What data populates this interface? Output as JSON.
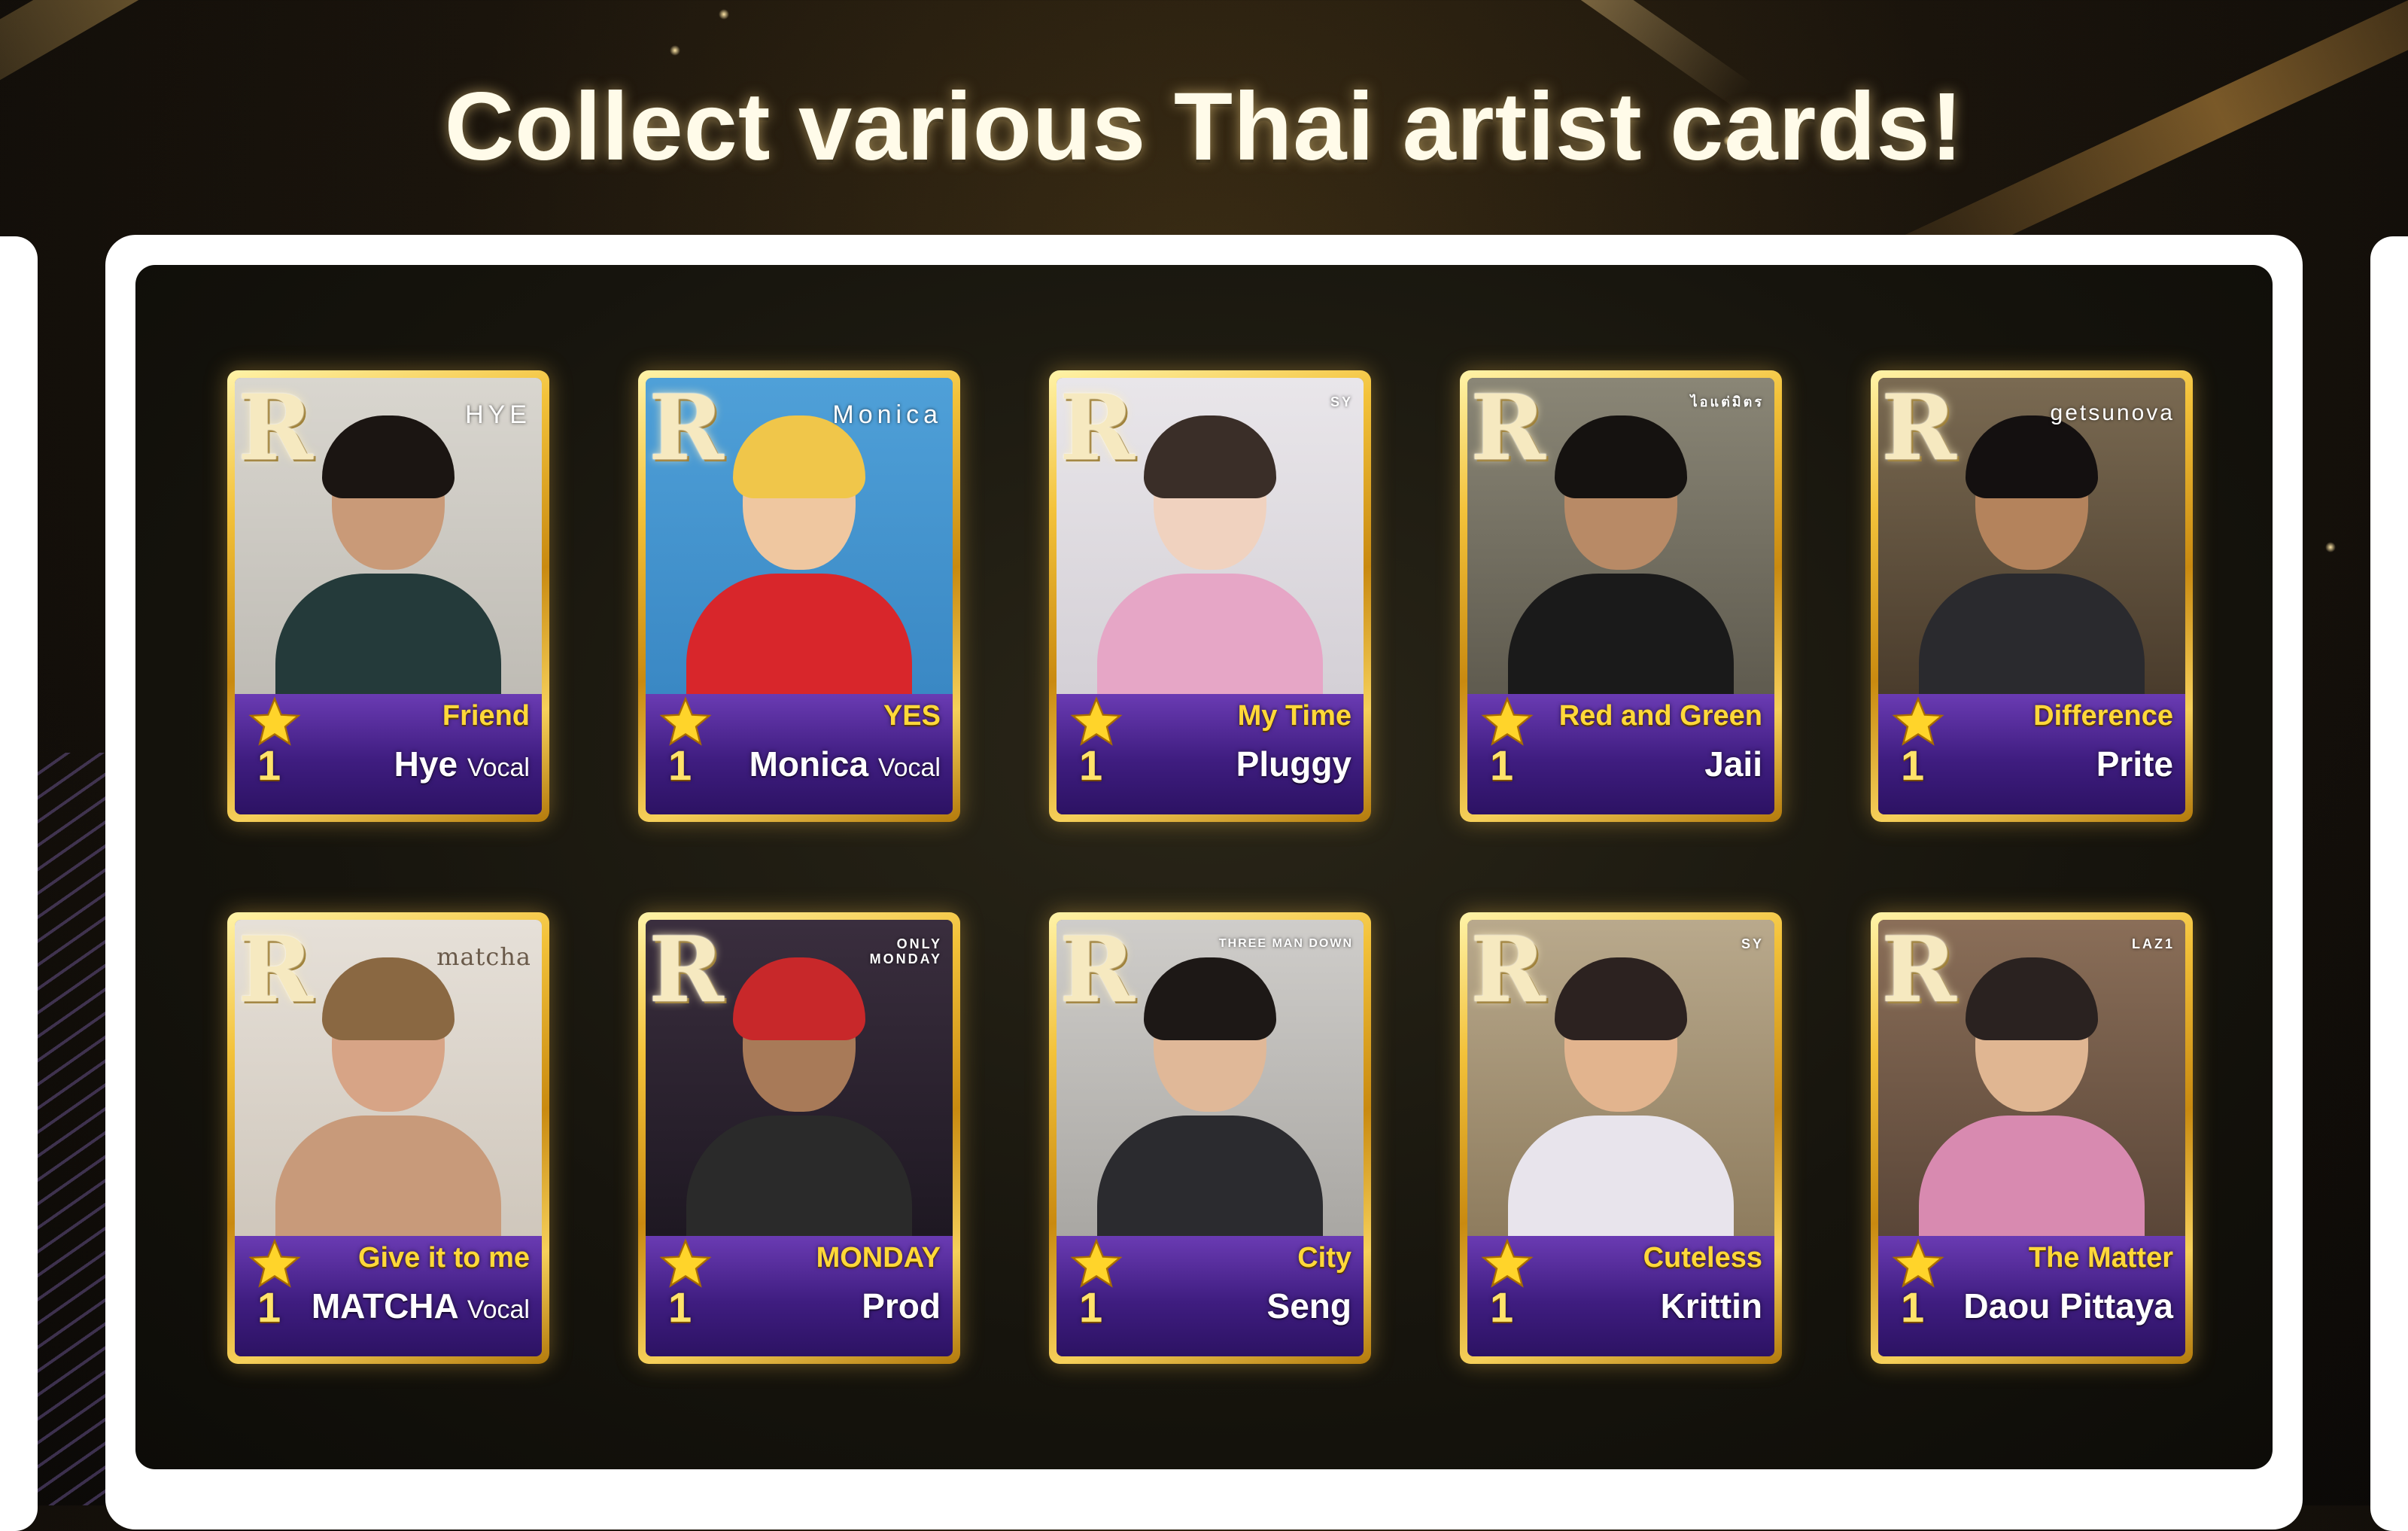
{
  "headline": "Collect various Thai artist cards!",
  "accent_color": "#f3c23a",
  "info_panel_color": "#3f1d80",
  "cards": [
    {
      "rarity": "R",
      "brand": "HYE",
      "song": "Friend",
      "artist": "Hye",
      "role": "Vocal",
      "stars": "1"
    },
    {
      "rarity": "R",
      "brand": "Monica",
      "song": "YES",
      "artist": "Monica",
      "role": "Vocal",
      "stars": "1"
    },
    {
      "rarity": "R",
      "brand": "SY",
      "song": "My Time",
      "artist": "Pluggy",
      "role": "",
      "stars": "1"
    },
    {
      "rarity": "R",
      "brand": "ไอแต่มิตร",
      "song": "Red and Green",
      "artist": "Jaii",
      "role": "",
      "stars": "1"
    },
    {
      "rarity": "R",
      "brand": "getsunova",
      "song": "Difference",
      "artist": "Prite",
      "role": "",
      "stars": "1"
    },
    {
      "rarity": "R",
      "brand": "matcha",
      "song": "Give it to me",
      "artist": "MATCHA",
      "role": "Vocal",
      "stars": "1"
    },
    {
      "rarity": "R",
      "brand": "ONLY MONDAY",
      "song": "MONDAY",
      "artist": "Prod",
      "role": "",
      "stars": "1"
    },
    {
      "rarity": "R",
      "brand": "THREE MAN DOWN",
      "song": "City",
      "artist": "Seng",
      "role": "",
      "stars": "1"
    },
    {
      "rarity": "R",
      "brand": "SY",
      "song": "Cuteless",
      "artist": "Krittin",
      "role": "",
      "stars": "1"
    },
    {
      "rarity": "R",
      "brand": "LAZ1",
      "song": "The Matter",
      "artist": "Daou Pittaya",
      "role": "",
      "stars": "1"
    }
  ]
}
